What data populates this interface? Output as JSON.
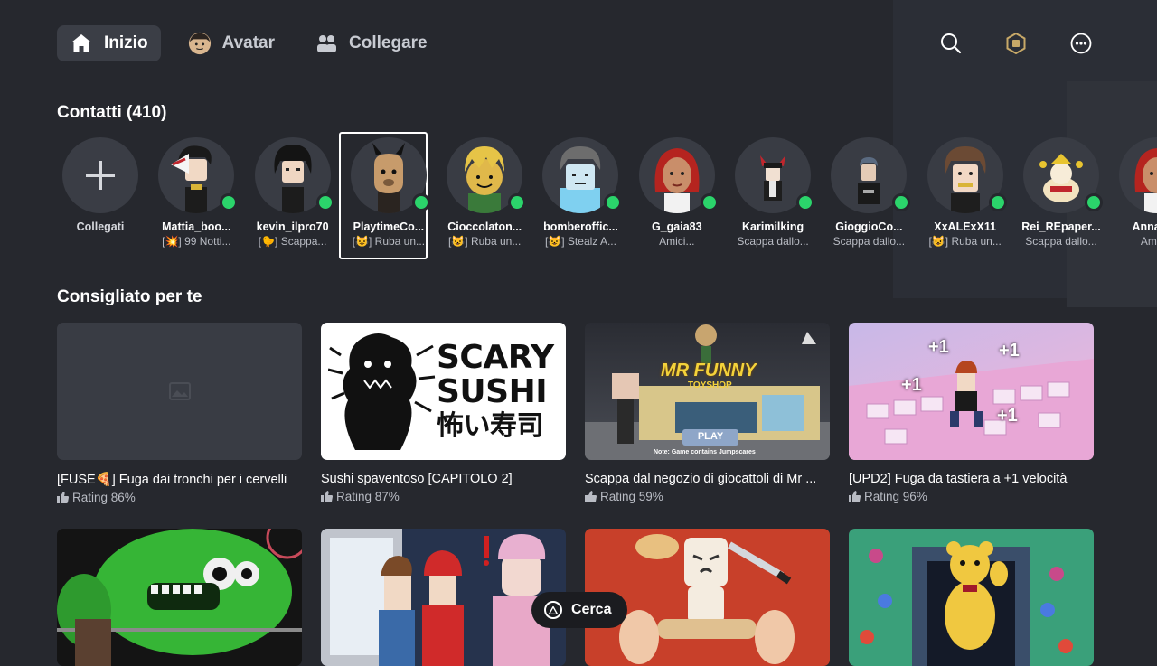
{
  "nav": {
    "home_label": "Inizio",
    "avatar_label": "Avatar",
    "connect_label": "Collegare",
    "icons": [
      "search-icon",
      "robux-icon",
      "more-icon"
    ]
  },
  "contacts": {
    "title": "Contatti (410)",
    "add_label": "Collegati",
    "friends": [
      {
        "name": "Mattia_boo...",
        "status": "[💥] 99 Notti..."
      },
      {
        "name": "kevin_ilpro70",
        "status": "[🐤] Scappa..."
      },
      {
        "name": "PlaytimeCo...",
        "status": "[😺] Ruba un..."
      },
      {
        "name": "Cioccolaton...",
        "status": "[😺] Ruba un..."
      },
      {
        "name": "bomberoffic...",
        "status": "[😺] Stealz A..."
      },
      {
        "name": "G_gaia83",
        "status": "Amici..."
      },
      {
        "name": "Karimilking",
        "status": "Scappa dallo..."
      },
      {
        "name": "GioggioCo...",
        "status": "Scappa dallo..."
      },
      {
        "name": "XxALExX11",
        "status": "[😺] Ruba un..."
      },
      {
        "name": "Rei_REpaper...",
        "status": "Scappa dallo..."
      },
      {
        "name": "Anna_s...",
        "status": "Amic..."
      }
    ]
  },
  "recommended": {
    "title": "Consigliato per te",
    "games": [
      {
        "title": "[FUSE🍕] Fuga dai tronchi per i cervelli",
        "rating": "Rating 86%"
      },
      {
        "title": "Sushi spaventoso [CAPITOLO 2]",
        "rating": "Rating 87%"
      },
      {
        "title": "Scappa dal negozio di giocattoli di Mr ...",
        "rating": "Rating 59%"
      },
      {
        "title": "[UPD2] Fuga da tastiera a +1 velocità",
        "rating": "Rating 96%"
      }
    ],
    "thumb_text": {
      "sushi_line1": "SCARY",
      "sushi_line2": "SUSHI",
      "sushi_line3": "怖い寿司",
      "funny_title": "MR FUNNY",
      "funny_sub": "TOYSHOP",
      "funny_play": "PLAY",
      "funny_note": "Note: Game contains Jumpscares",
      "plus_one": "+1"
    }
  },
  "search_pill": {
    "label": "Cerca"
  },
  "colors": {
    "background": "#26282e",
    "online": "#2bd46b"
  }
}
